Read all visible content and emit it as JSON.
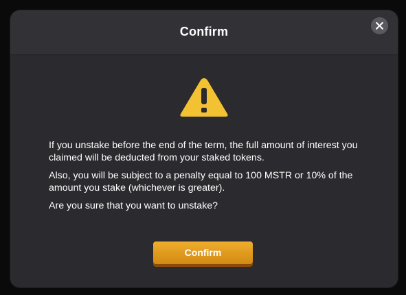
{
  "modal": {
    "title": "Confirm",
    "close_icon": "close-icon",
    "warning_icon": "warning-triangle-icon",
    "message_lines": [
      "If you unstake before the end of the term, the full amount of interest you claimed will be deducted from your staked tokens.",
      "Also, you will be subject to a penalty equal to 100 MSTR or 10% of the amount you stake (whichever is greater).",
      "Are you sure that you want to unstake?"
    ],
    "confirm_label": "Confirm"
  },
  "colors": {
    "modal_bg": "#2b2a2e",
    "header_bg": "#323135",
    "accent": "#f2b42c",
    "button_top": "#f0ad2c",
    "button_bottom": "#d18a12"
  }
}
